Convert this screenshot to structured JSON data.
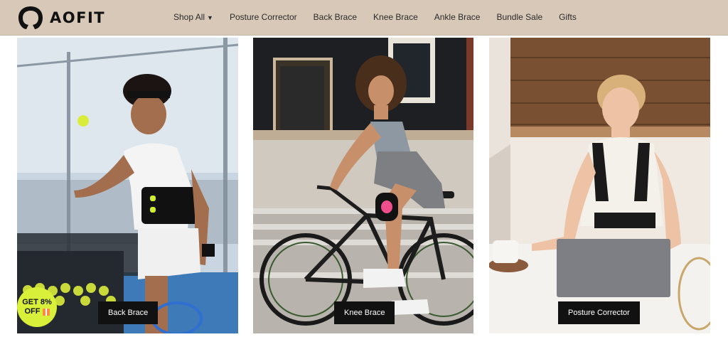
{
  "brand": {
    "name": "AOFIT",
    "logo_icon": "aofit-logo-icon"
  },
  "nav": {
    "items": [
      {
        "label": "Shop All",
        "has_dropdown": true
      },
      {
        "label": "Posture Corrector"
      },
      {
        "label": "Back Brace"
      },
      {
        "label": "Knee Brace"
      },
      {
        "label": "Ankle Brace"
      },
      {
        "label": "Bundle Sale"
      },
      {
        "label": "Gifts"
      }
    ]
  },
  "cards": [
    {
      "button": "Back Brace",
      "image": "tennis-player-with-back-brace"
    },
    {
      "button": "Knee Brace",
      "image": "cyclist-with-knee-brace"
    },
    {
      "button": "Posture Corrector",
      "image": "woman-with-posture-corrector-at-laptop"
    }
  ],
  "promo": {
    "line1": "GET 8%",
    "line2": "OFF",
    "icon": "gift-icon"
  },
  "colors": {
    "header_bg": "#d8c8b8",
    "button_bg": "#111111",
    "promo_bg": "#d8f03a"
  }
}
